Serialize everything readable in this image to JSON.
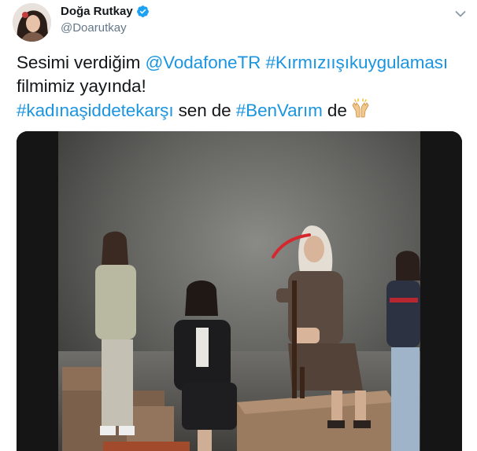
{
  "author": {
    "display_name": "Doğa Rutkay",
    "handle": "@Doarutkay",
    "verified": true,
    "avatar_icon": "profile-photo"
  },
  "tweet": {
    "line1_prefix": "Sesimi verdiğim ",
    "mention": "@VodafoneTR",
    "hashtag1": "#Kırmızıışıkuygulaması",
    "line2": "filmimiz  yayında!",
    "hashtag2": "#kadınaşiddetekarşı",
    "mid_text": " sen de ",
    "hashtag3": "#BenVarım",
    "end_text": " de",
    "emoji_icon": "raising-hands-emoji"
  },
  "media": {
    "type": "video",
    "description_icon": "video-frame"
  },
  "colors": {
    "link": "#1b95e0",
    "verified": "#1da1f2",
    "secondary_text": "#657786"
  }
}
